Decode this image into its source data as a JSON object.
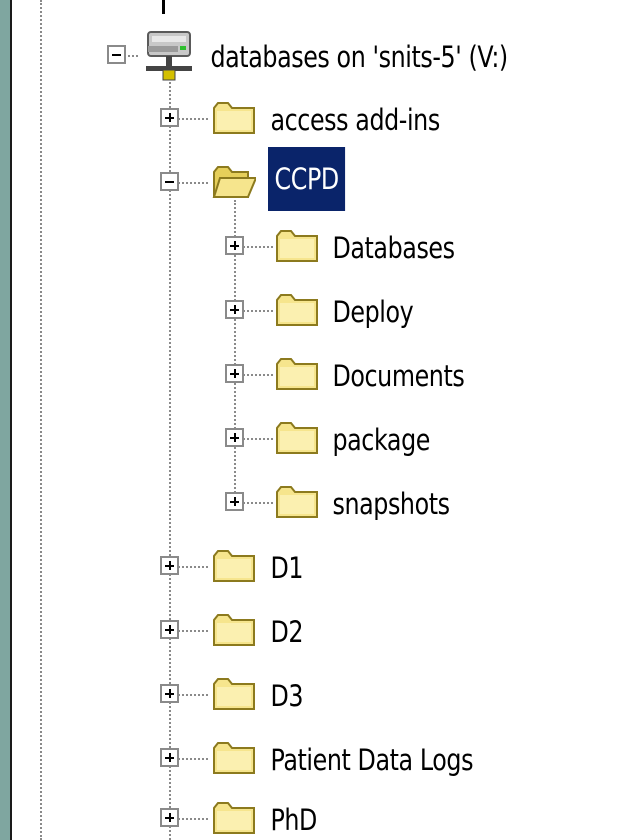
{
  "tree": {
    "root": {
      "label": "databases on 'snits-5' (V:)",
      "icon": "network-drive-icon",
      "expanded": true
    },
    "children": [
      {
        "label": "access add-ins",
        "expanded": false
      },
      {
        "label": "CCPD",
        "expanded": true,
        "selected": true,
        "children": [
          {
            "label": "Databases",
            "expanded": false
          },
          {
            "label": "Deploy",
            "expanded": false
          },
          {
            "label": "Documents",
            "expanded": false
          },
          {
            "label": "package",
            "expanded": false
          },
          {
            "label": "snapshots",
            "expanded": false
          }
        ]
      },
      {
        "label": "D1",
        "expanded": false
      },
      {
        "label": "D2",
        "expanded": false
      },
      {
        "label": "D3",
        "expanded": false
      },
      {
        "label": "Patient Data Logs",
        "expanded": false
      },
      {
        "label": "PhD",
        "expanded": false
      }
    ]
  },
  "colors": {
    "selection_bg": "#0a246a",
    "folder_fill": "#f6e58d",
    "folder_stroke": "#8c7a1e",
    "panel_bg": "#ffffff",
    "outer_bg": "#7fa6a0"
  }
}
